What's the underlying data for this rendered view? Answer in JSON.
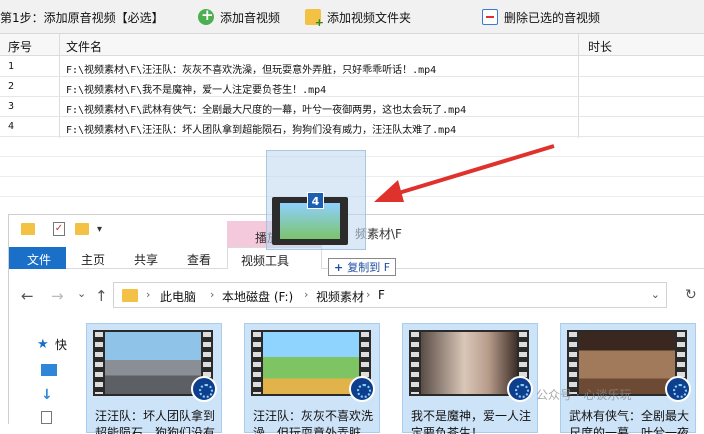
{
  "toolbar": {
    "step_label": "第1步：添加原音视频【必选】",
    "add_video_label": "添加音视频",
    "add_folder_label": "添加视频文件夹",
    "delete_selected_label": "删除已选的音视频"
  },
  "table": {
    "headers": {
      "index": "序号",
      "filename": "文件名",
      "duration": "时长"
    },
    "rows": [
      {
        "num": "1",
        "name": "F:\\视频素材\\F\\汪汪队：灰灰不喜欢洗澡，但玩耍意外弄脏，只好乖乖听话！.mp4",
        "duration": ""
      },
      {
        "num": "2",
        "name": "F:\\视频素材\\F\\我不是魔神，爱一人注定要负苍生！.mp4",
        "duration": ""
      },
      {
        "num": "3",
        "name": "F:\\视频素材\\F\\武林有侠气：全剧最大尺度的一幕，叶兮一夜御两男，这也太会玩了.mp4",
        "duration": ""
      },
      {
        "num": "4",
        "name": "F:\\视频素材\\F\\汪汪队：坏人团队拿到超能陨石，狗狗们没有威力，汪汪队太难了.mp4",
        "duration": ""
      }
    ]
  },
  "drag": {
    "count": "4",
    "copy_tip": "复制到 F",
    "copy_plus": "+"
  },
  "explorer": {
    "quick_access_dropdown": "▾",
    "contextual_tab": "播放",
    "title_path": "频素材\\F",
    "ribbon_tabs": {
      "file": "文件",
      "home": "主页",
      "share": "共享",
      "view": "查看",
      "video_tools": "视频工具"
    },
    "nav": {
      "back": "←",
      "forward": "→",
      "recent": "⌄",
      "up": "↑",
      "refresh": "↻"
    },
    "breadcrumb": [
      "此电脑",
      "本地磁盘 (F:)",
      "视频素材",
      "F"
    ],
    "crumb_separator": "›",
    "addr_dropdown": "⌄",
    "sidebar": {
      "quick_access_label": "快"
    },
    "tiles": [
      {
        "caption": "汪汪队：坏人团队拿到超能陨石，狗狗们没有威力"
      },
      {
        "caption": "汪汪队：灰灰不喜欢洗澡，但玩耍意外弄脏"
      },
      {
        "caption": "我不是魔神，爱一人注定要负苍生！"
      },
      {
        "caption": "武林有侠气：全剧最大尺度的一幕，叶兮一夜"
      }
    ]
  },
  "watermark": "公众号 · 心谈乐玩",
  "colors": {
    "ribbon_file": "#1a6fc9",
    "selection": "#cde3f7",
    "arrow": "#e0322d",
    "play_tab": "#f5c9dc"
  },
  "icons": [
    "add-icon",
    "folder-add-icon",
    "delete-icon",
    "film-icon",
    "video-badge-icon",
    "folder-icon",
    "pin-icon",
    "desktop-icon",
    "download-icon",
    "document-icon"
  ]
}
